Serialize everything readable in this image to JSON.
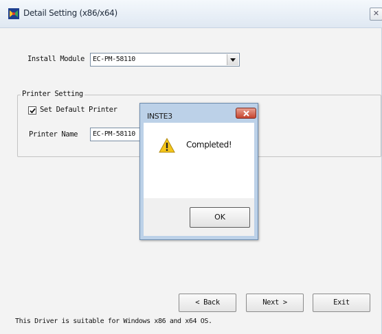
{
  "window": {
    "title": "Detail Setting (x86/x64)",
    "close_glyph": "✕"
  },
  "form": {
    "install_module_label": "Install Module",
    "install_module_value": "EC-PM-58110",
    "printer_setting_legend": "Printer Setting",
    "set_default_label": "Set Default Printer",
    "set_default_checked": true,
    "printer_name_label": "Printer Name",
    "printer_name_value": "EC-PM-58110"
  },
  "buttons": {
    "back": "< Back",
    "next": "Next >",
    "exit": "Exit"
  },
  "footer": {
    "note": "This Driver is suitable for Windows x86 and x64 OS."
  },
  "dialog": {
    "title": "INSTE3",
    "message": "Completed!",
    "ok": "OK",
    "icon": "warning-icon"
  },
  "colors": {
    "dialog_frame": "#bcd1e8",
    "close_red": "#c6452f",
    "warning_yellow": "#f5c518"
  }
}
